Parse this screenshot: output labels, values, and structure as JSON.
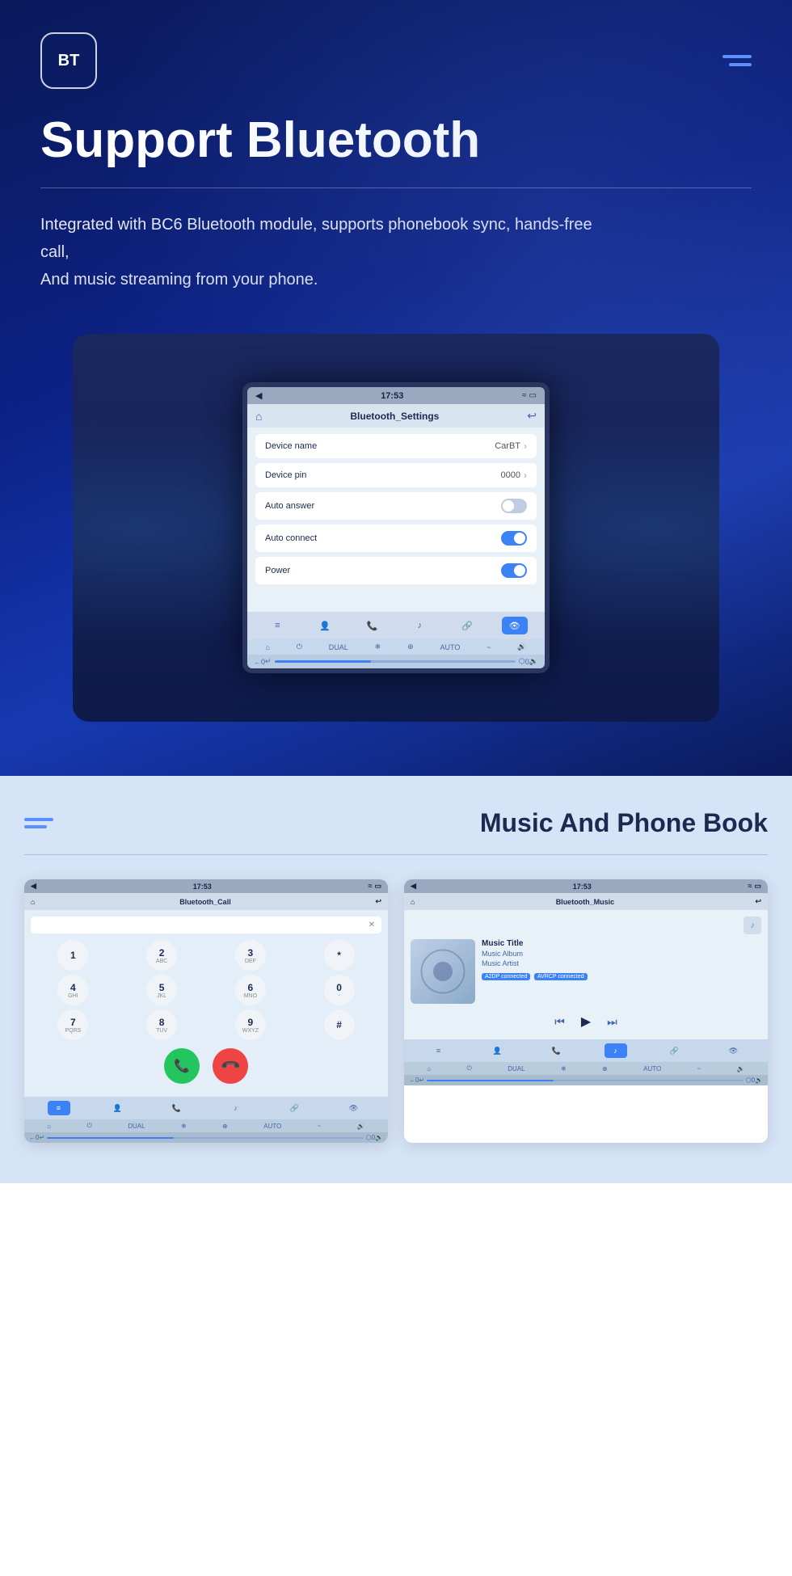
{
  "hero": {
    "logo": "BT",
    "title": "Support Bluetooth",
    "description_line1": "Integrated with BC6 Bluetooth module, supports phonebook sync, hands-free call,",
    "description_line2": "And music streaming from your phone.",
    "screen": {
      "status_time": "17:53",
      "nav_title": "Bluetooth_Settings",
      "settings": [
        {
          "label": "Device name",
          "value": "CarBT",
          "type": "chevron"
        },
        {
          "label": "Device pin",
          "value": "0000",
          "type": "chevron"
        },
        {
          "label": "Auto answer",
          "value": "",
          "type": "toggle_off"
        },
        {
          "label": "Auto connect",
          "value": "",
          "type": "toggle_on"
        },
        {
          "label": "Power",
          "value": "",
          "type": "toggle_on"
        }
      ]
    }
  },
  "bottom": {
    "section_title": "Music And Phone Book",
    "call_screen": {
      "status_time": "17:53",
      "nav_title": "Bluetooth_Call",
      "keypad": [
        {
          "main": "1",
          "sub": ""
        },
        {
          "main": "2",
          "sub": "ABC"
        },
        {
          "main": "3",
          "sub": "DEF"
        },
        {
          "main": "*",
          "sub": ""
        },
        {
          "main": "4",
          "sub": "GHI"
        },
        {
          "main": "5",
          "sub": "JKL"
        },
        {
          "main": "6",
          "sub": "MNO"
        },
        {
          "main": "0",
          "sub": ""
        },
        {
          "main": "7",
          "sub": "PQRS"
        },
        {
          "main": "8",
          "sub": "TUV"
        },
        {
          "main": "9",
          "sub": "WXYZ"
        },
        {
          "main": "#",
          "sub": ""
        }
      ],
      "call_btn_answer": "📞",
      "call_btn_hangup": "📞"
    },
    "music_screen": {
      "status_time": "17:53",
      "nav_title": "Bluetooth_Music",
      "music_title": "Music Title",
      "music_album": "Music Album",
      "music_artist": "Music Artist",
      "badge1": "A2DP connected",
      "badge2": "AVRCP connected"
    }
  }
}
